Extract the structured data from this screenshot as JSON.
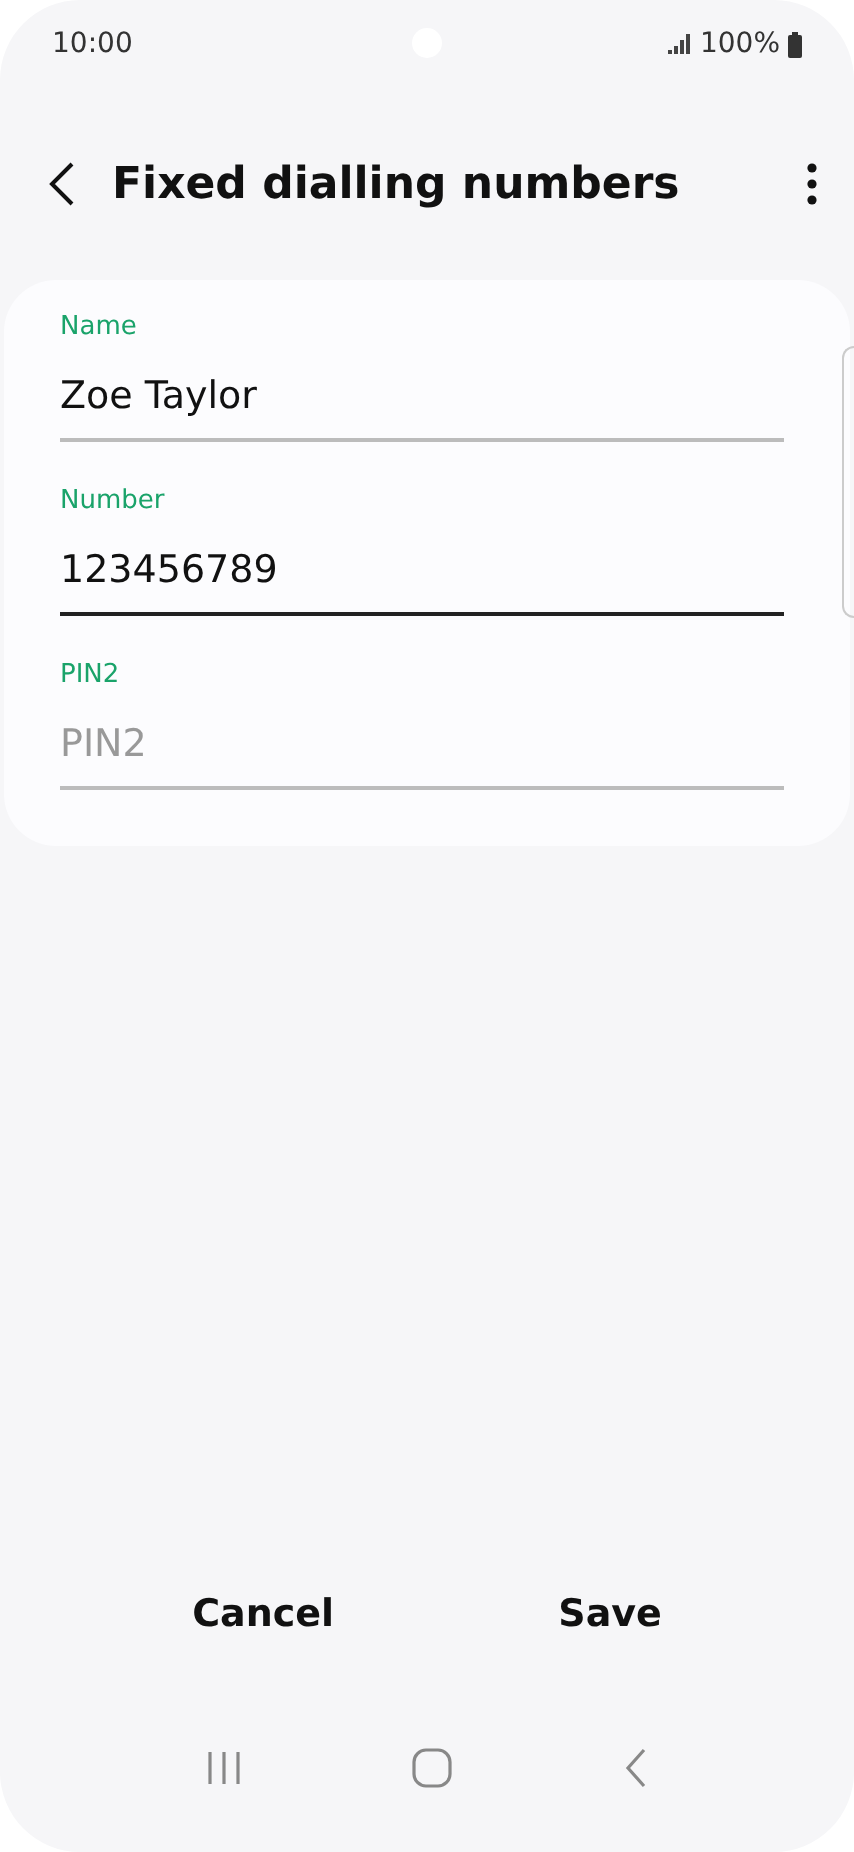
{
  "status_bar": {
    "time": "10:00",
    "battery": "100%"
  },
  "header": {
    "title": "Fixed dialling numbers"
  },
  "fields": [
    {
      "label": "Name",
      "value": "Zoe Taylor",
      "focused": false
    },
    {
      "label": "Number",
      "value": "123456789",
      "focused": true
    },
    {
      "label": "PIN2",
      "placeholder": "PIN2",
      "focused": false
    }
  ],
  "buttons": [
    "Cancel",
    "Save"
  ]
}
